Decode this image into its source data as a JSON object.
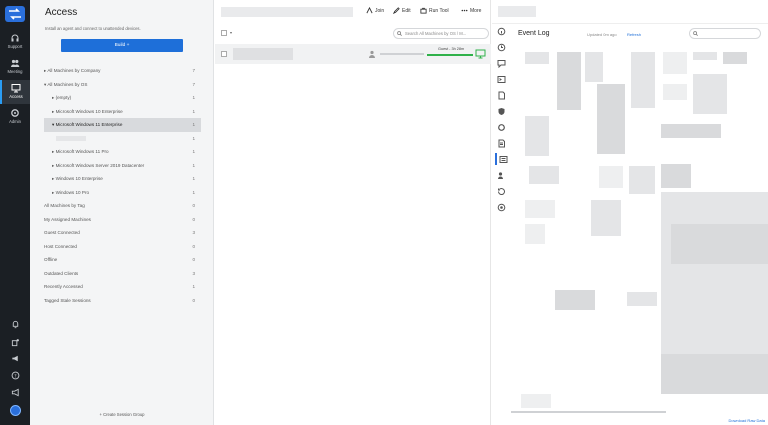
{
  "rail": {
    "items": [
      {
        "label": "Support",
        "icon": "headset-icon"
      },
      {
        "label": "Meeting",
        "icon": "people-icon"
      },
      {
        "label": "Access",
        "icon": "monitor-icon"
      },
      {
        "label": "Admin",
        "icon": "gear-icon"
      }
    ],
    "bottom_icons": [
      "bell-icon",
      "extension-icon",
      "megaphone-icon",
      "help-icon",
      "announce-icon",
      "avatar-icon"
    ]
  },
  "access": {
    "title": "Access",
    "hint": "Install an agent and connect to unattended devices.",
    "build_label": "Build +",
    "tree": [
      {
        "label": "▸ All Machines by Company",
        "count": "7"
      },
      {
        "label": "▾ All Machines by OS",
        "count": "7"
      },
      {
        "label": "▸ (empty)",
        "count": "1"
      },
      {
        "label": "▸ Microsoft Windows 10 Enterprise",
        "count": "1"
      },
      {
        "label": "▾ Microsoft Windows 11 Enterprise",
        "count": "1"
      },
      {
        "label": "",
        "count": "1"
      },
      {
        "label": "▸ Microsoft Windows 11 Pro",
        "count": "1"
      },
      {
        "label": "▸ Microsoft Windows Server 2019 Datacenter",
        "count": "1"
      },
      {
        "label": "▸ Windows 10 Enterprise",
        "count": "1"
      },
      {
        "label": "▸ Windows 10 Pro",
        "count": "1"
      },
      {
        "label": "All Machines by Tag",
        "count": "0"
      },
      {
        "label": "My Assigned Machines",
        "count": "0"
      },
      {
        "label": "Guest Connected",
        "count": "3"
      },
      {
        "label": "Host Connected",
        "count": "0"
      },
      {
        "label": "Offline",
        "count": "0"
      },
      {
        "label": "Outdated Clients",
        "count": "3"
      },
      {
        "label": "Recently Accessed",
        "count": "1"
      },
      {
        "label": "Tagged Stale Sessions",
        "count": "0"
      }
    ],
    "create_label": "+ Create Session Group"
  },
  "toolbar": {
    "join": "Join",
    "edit": "Edit",
    "run_tool": "Run Tool",
    "more": "More"
  },
  "list": {
    "search_placeholder": "Search All Machines by OS / M...",
    "guest_label": "Guest - 3h 28m"
  },
  "event_log": {
    "title": "Event Log",
    "updated": "Updated 0m ago",
    "refresh": "Refresh",
    "download": "Download Raw Data"
  },
  "colors": {
    "rail_bg": "#1b1f24",
    "accent": "#1e6fd9",
    "guest_green": "#2fb14a"
  }
}
